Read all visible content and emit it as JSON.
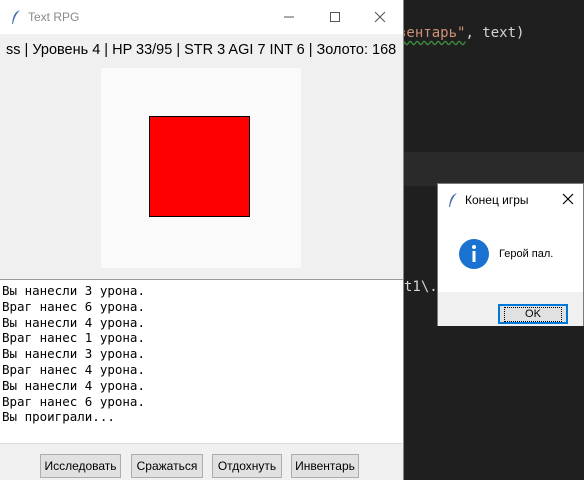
{
  "editor": {
    "line1_str": "вентарь\"",
    "line1_rest": ", text)",
    "line2": "t1\\."
  },
  "window": {
    "title": "Text RPG",
    "status": "ss | Уровень 4 | HP 33/95 | STR 3 AGI 7 INT 6 | Золото: 168",
    "colors": {
      "monster": "#ff0000",
      "canvas": "#fafafa"
    },
    "log": [
      "Вы нанесли 3 урона.",
      "Враг нанес 6 урона.",
      "Вы нанесли 4 урона.",
      "Враг нанес 1 урона.",
      "Вы нанесли 3 урона.",
      "Враг нанес 4 урона.",
      "Вы нанесли 4 урона.",
      "Враг нанес 6 урона.",
      "Вы проиграли..."
    ],
    "buttons": [
      "Исследовать",
      "Сражаться",
      "Отдохнуть",
      "Инвентарь"
    ]
  },
  "dialog": {
    "title": "Конец игры",
    "message": "Герой пал.",
    "ok_label": "OK",
    "icon": "info-icon"
  }
}
